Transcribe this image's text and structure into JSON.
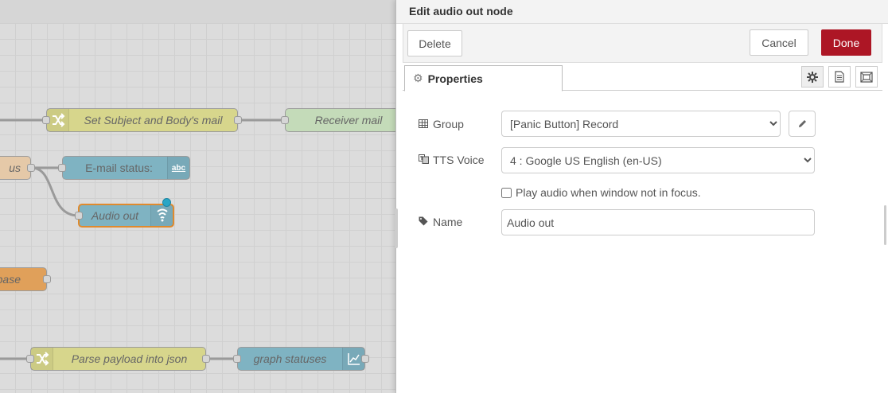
{
  "canvas": {
    "nodes": {
      "set_subject": "Set Subject and Body's mail",
      "receiver_mail": "Receiver mail",
      "left_status_fragment": "us",
      "email_status": "E-mail status:",
      "email_status_badge": "abc",
      "audio_out": "Audio out",
      "database_fragment": "base",
      "parse_payload": "Parse payload into json",
      "graph_statuses": "graph statuses"
    },
    "colors": {
      "function_node": "#d7d68c",
      "email_node": "#c4dbb9",
      "dashboard_node": "#7fb3c2",
      "database_node": "#e0a05a",
      "status_node": "#e5c9a8",
      "done_button": "#ad1625"
    }
  },
  "tray": {
    "title": "Edit audio out node",
    "delete_label": "Delete",
    "cancel_label": "Cancel",
    "done_label": "Done",
    "tab_properties": "Properties",
    "form": {
      "group_label": "Group",
      "group_value": "[Panic Button] Record",
      "voice_label": "TTS Voice",
      "voice_value": "4 : Google US English (en-US)",
      "play_checkbox_label": "Play audio when window not in focus.",
      "play_checked": false,
      "name_label": "Name",
      "name_value": "Audio out"
    },
    "icons": [
      "gear-icon",
      "description-icon",
      "appearance-icon",
      "table-icon",
      "translate-icon",
      "tag-icon",
      "pencil-icon"
    ]
  }
}
